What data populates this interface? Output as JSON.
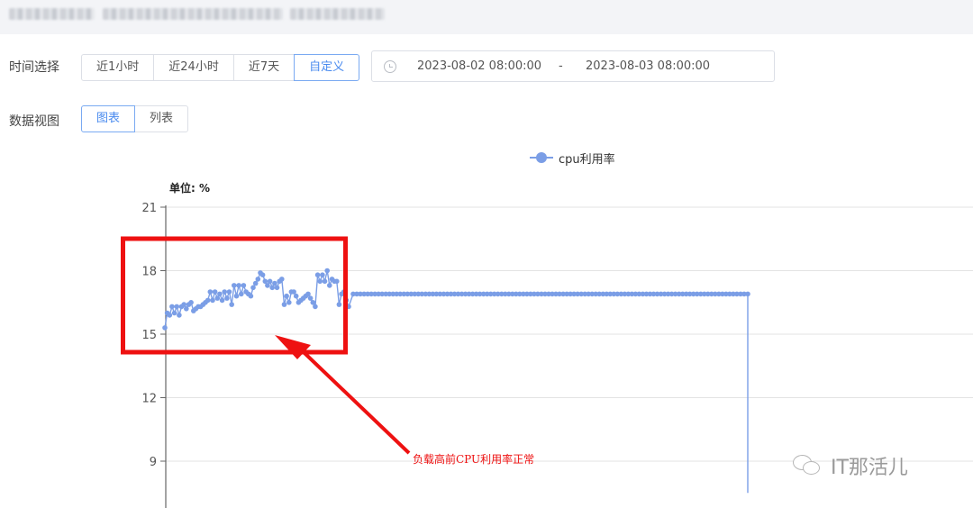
{
  "time_select": {
    "label": "时间选择",
    "options": [
      "近1小时",
      "近24小时",
      "近7天",
      "自定义"
    ],
    "active": "自定义"
  },
  "date_range": {
    "start": "2023-08-02 08:00:00",
    "separator": "-",
    "end": "2023-08-03 08:00:00"
  },
  "data_view": {
    "label": "数据视图",
    "options": [
      "图表",
      "列表"
    ],
    "active": "图表"
  },
  "annotation": {
    "text": "负载高前CPU利用率正常"
  },
  "watermark": {
    "text": "IT那活儿"
  },
  "colors": {
    "accent": "#4a8bef",
    "series": "#7b9ee6",
    "annotation": "#ee1111"
  },
  "chart_data": {
    "type": "line",
    "unit_label": "单位: %",
    "yticks": [
      21,
      18,
      15,
      12,
      9
    ],
    "grid": true,
    "legend_placement": "top-center",
    "series": [
      {
        "name": "cpu利用率",
        "values": [
          15.3,
          16.0,
          15.9,
          16.3,
          16.0,
          16.3,
          15.9,
          16.3,
          16.4,
          16.2,
          16.4,
          16.5,
          16.1,
          16.2,
          16.3,
          16.3,
          16.4,
          16.5,
          16.6,
          17.0,
          16.6,
          17.0,
          16.7,
          16.9,
          16.6,
          17.0,
          16.7,
          17.0,
          16.4,
          17.3,
          16.8,
          17.3,
          16.9,
          17.3,
          17.0,
          16.9,
          16.8,
          17.2,
          17.4,
          17.6,
          17.9,
          17.8,
          17.5,
          17.3,
          17.5,
          17.2,
          17.4,
          17.2,
          17.5,
          17.6,
          16.4,
          16.8,
          16.5,
          17.0,
          17.0,
          16.8,
          16.5,
          16.6,
          16.7,
          16.8,
          16.9,
          16.7,
          16.5,
          16.3,
          17.8,
          17.5,
          17.8,
          17.5,
          18.0,
          17.3,
          17.6,
          17.5,
          17.5,
          16.4,
          16.9,
          17.0,
          16.6,
          16.3
        ],
        "plateau_value": 16.9,
        "plateau_points": 110,
        "final_drop_value": 7.5
      }
    ]
  }
}
